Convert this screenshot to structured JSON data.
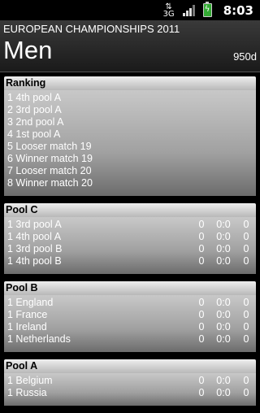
{
  "status": {
    "network": "3G",
    "time": "8:03"
  },
  "header": {
    "title": "EUROPEAN CHAMPIONSHIPS 2011",
    "gender": "Men",
    "distance": "950d"
  },
  "ranking": {
    "title": "Ranking",
    "rows": [
      "1 4th pool A",
      "2 3rd pool A",
      "3 2nd pool A",
      "4 1st pool A",
      "5 Looser match 19",
      "6 Winner match 19",
      "7 Looser match 20",
      "8 Winner match 20"
    ]
  },
  "pools": [
    {
      "title": "Pool C",
      "rows": [
        {
          "name": "1 3rd pool A",
          "a": "0",
          "b": "0:0",
          "c": "0"
        },
        {
          "name": "1 4th pool A",
          "a": "0",
          "b": "0:0",
          "c": "0"
        },
        {
          "name": "1 3rd pool B",
          "a": "0",
          "b": "0:0",
          "c": "0"
        },
        {
          "name": "1 4th pool B",
          "a": "0",
          "b": "0:0",
          "c": "0"
        }
      ]
    },
    {
      "title": "Pool B",
      "rows": [
        {
          "name": "1 England",
          "a": "0",
          "b": "0:0",
          "c": "0"
        },
        {
          "name": "1 France",
          "a": "0",
          "b": "0:0",
          "c": "0"
        },
        {
          "name": "1 Ireland",
          "a": "0",
          "b": "0:0",
          "c": "0"
        },
        {
          "name": "1 Netherlands",
          "a": "0",
          "b": "0:0",
          "c": "0"
        }
      ]
    },
    {
      "title": "Pool A",
      "rows": [
        {
          "name": "1 Belgium",
          "a": "0",
          "b": "0:0",
          "c": "0"
        },
        {
          "name": "1 Russia",
          "a": "0",
          "b": "0:0",
          "c": "0"
        }
      ]
    }
  ]
}
